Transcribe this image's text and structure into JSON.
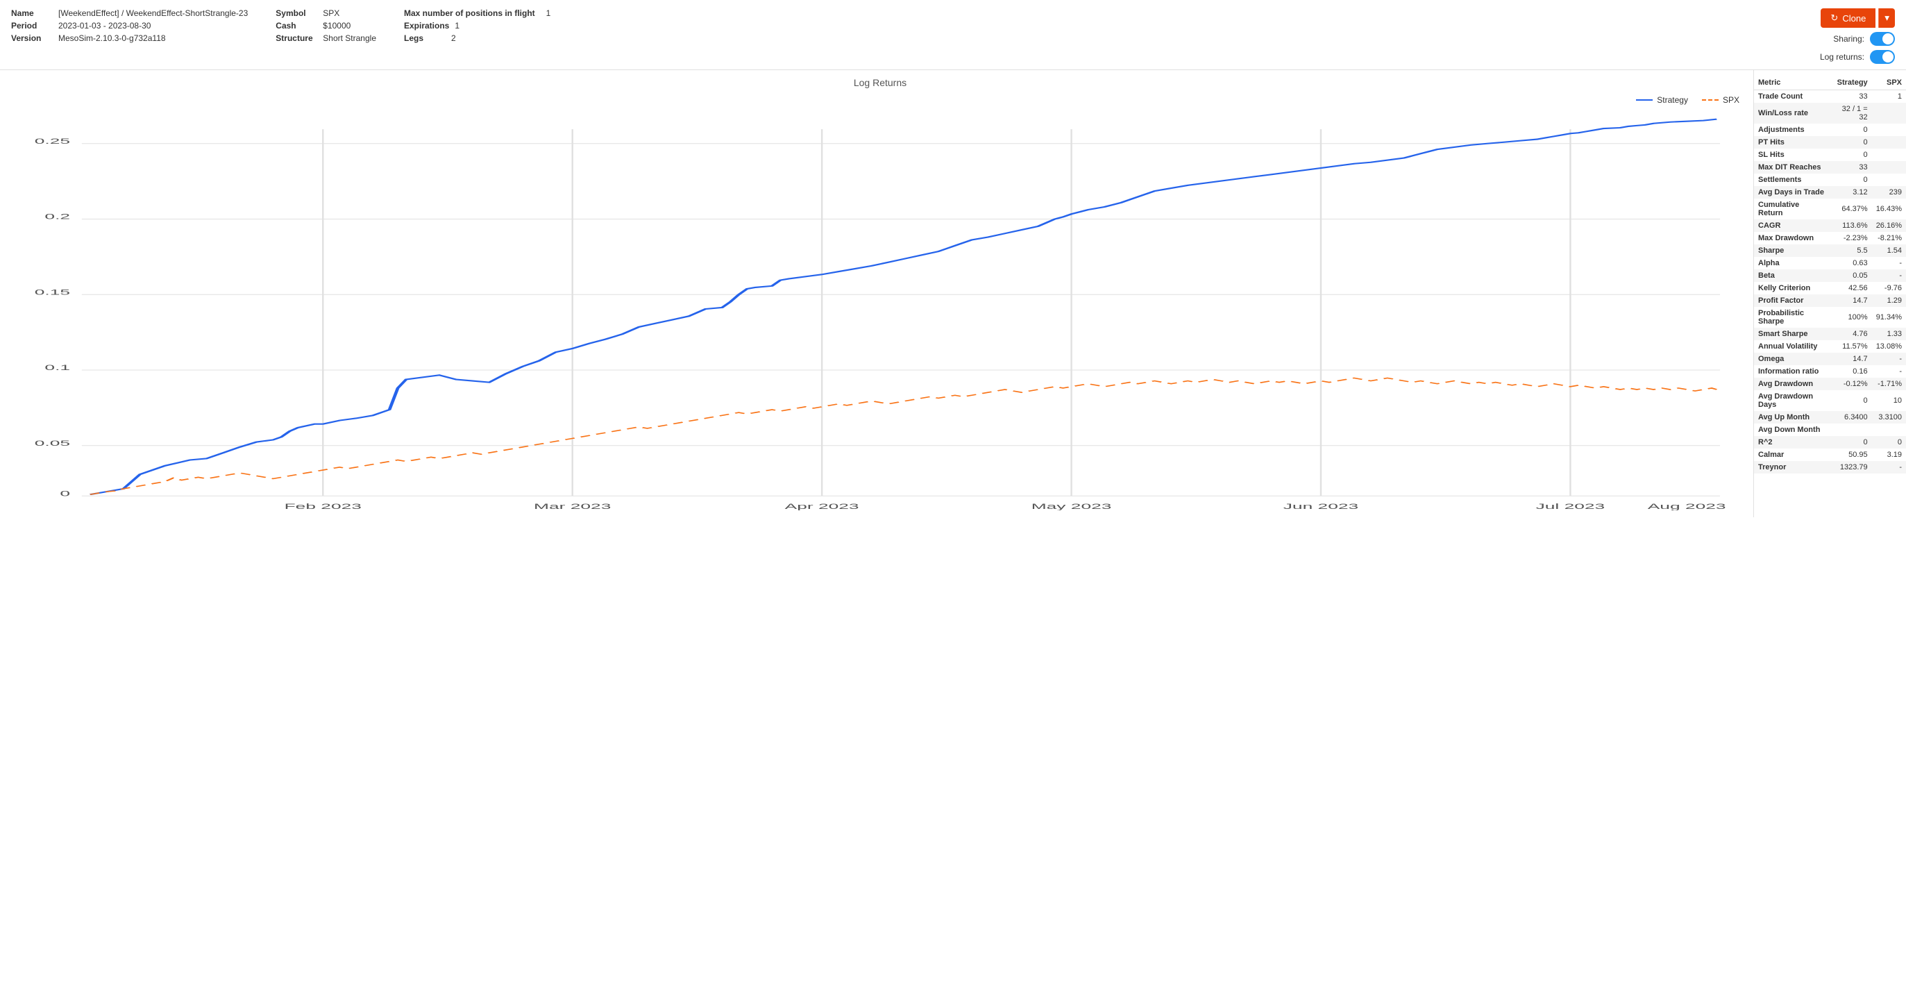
{
  "header": {
    "name_label": "Name",
    "name_value": "[WeekendEffect] / WeekendEffect-ShortStrangle-23",
    "period_label": "Period",
    "period_value": "2023-01-03 - 2023-08-30",
    "version_label": "Version",
    "version_value": "MesoSim-2.10.3-0-g732a118",
    "symbol_label": "Symbol",
    "symbol_value": "SPX",
    "cash_label": "Cash",
    "cash_value": "$10000",
    "structure_label": "Structure",
    "structure_value": "Short Strangle",
    "max_positions_label": "Max number of positions in flight",
    "max_positions_value": "1",
    "expirations_label": "Expirations",
    "expirations_value": "1",
    "legs_label": "Legs",
    "legs_value": "2",
    "clone_label": "Clone",
    "sharing_label": "Sharing:",
    "log_returns_label": "Log returns:"
  },
  "chart": {
    "title": "Log Returns",
    "legend": {
      "strategy_label": "Strategy",
      "spx_label": "SPX"
    },
    "x_labels": [
      "Feb 2023",
      "Mar 2023",
      "Apr 2023",
      "May 2023",
      "Jun 2023",
      "Jul 2023",
      "Aug 2023"
    ],
    "y_labels": [
      "0.25",
      "0.2",
      "0.15",
      "0.1",
      "0.05",
      "0"
    ],
    "colors": {
      "strategy": "#2563EB",
      "spx": "#f97316"
    }
  },
  "metrics": {
    "header": {
      "metric": "Metric",
      "strategy": "Strategy",
      "spx": "SPX"
    },
    "rows": [
      {
        "label": "Trade Count",
        "strategy": "33",
        "spx": "1"
      },
      {
        "label": "Win/Loss rate",
        "strategy": "32 / 1 = 32",
        "spx": ""
      },
      {
        "label": "Adjustments",
        "strategy": "0",
        "spx": ""
      },
      {
        "label": "PT Hits",
        "strategy": "0",
        "spx": ""
      },
      {
        "label": "SL Hits",
        "strategy": "0",
        "spx": ""
      },
      {
        "label": "Max DIT Reaches",
        "strategy": "33",
        "spx": ""
      },
      {
        "label": "Settlements",
        "strategy": "0",
        "spx": ""
      },
      {
        "label": "Avg Days in Trade",
        "strategy": "3.12",
        "spx": "239"
      },
      {
        "label": "Cumulative Return",
        "strategy": "64.37%",
        "spx": "16.43%"
      },
      {
        "label": "CAGR",
        "strategy": "113.6%",
        "spx": "26.16%"
      },
      {
        "label": "Max Drawdown",
        "strategy": "-2.23%",
        "spx": "-8.21%"
      },
      {
        "label": "Sharpe",
        "strategy": "5.5",
        "spx": "1.54"
      },
      {
        "label": "Alpha",
        "strategy": "0.63",
        "spx": "-"
      },
      {
        "label": "Beta",
        "strategy": "0.05",
        "spx": "-"
      },
      {
        "label": "Kelly Criterion",
        "strategy": "42.56",
        "spx": "-9.76"
      },
      {
        "label": "Profit Factor",
        "strategy": "14.7",
        "spx": "1.29"
      },
      {
        "label": "Probabilistic Sharpe",
        "strategy": "100%",
        "spx": "91.34%"
      },
      {
        "label": "Smart Sharpe",
        "strategy": "4.76",
        "spx": "1.33"
      },
      {
        "label": "Annual Volatility",
        "strategy": "11.57%",
        "spx": "13.08%"
      },
      {
        "label": "Omega",
        "strategy": "14.7",
        "spx": "-"
      },
      {
        "label": "Information ratio",
        "strategy": "0.16",
        "spx": "-"
      },
      {
        "label": "Avg Drawdown",
        "strategy": "-0.12%",
        "spx": "-1.71%"
      },
      {
        "label": "Avg Drawdown Days",
        "strategy": "0",
        "spx": "10"
      },
      {
        "label": "Avg Up Month",
        "strategy": "6.3400",
        "spx": "3.3100"
      },
      {
        "label": "Avg Down Month",
        "strategy": "",
        "spx": ""
      },
      {
        "label": "R^2",
        "strategy": "0",
        "spx": "0"
      },
      {
        "label": "Calmar",
        "strategy": "50.95",
        "spx": "3.19"
      },
      {
        "label": "Treynor",
        "strategy": "1323.79",
        "spx": "-"
      }
    ]
  }
}
